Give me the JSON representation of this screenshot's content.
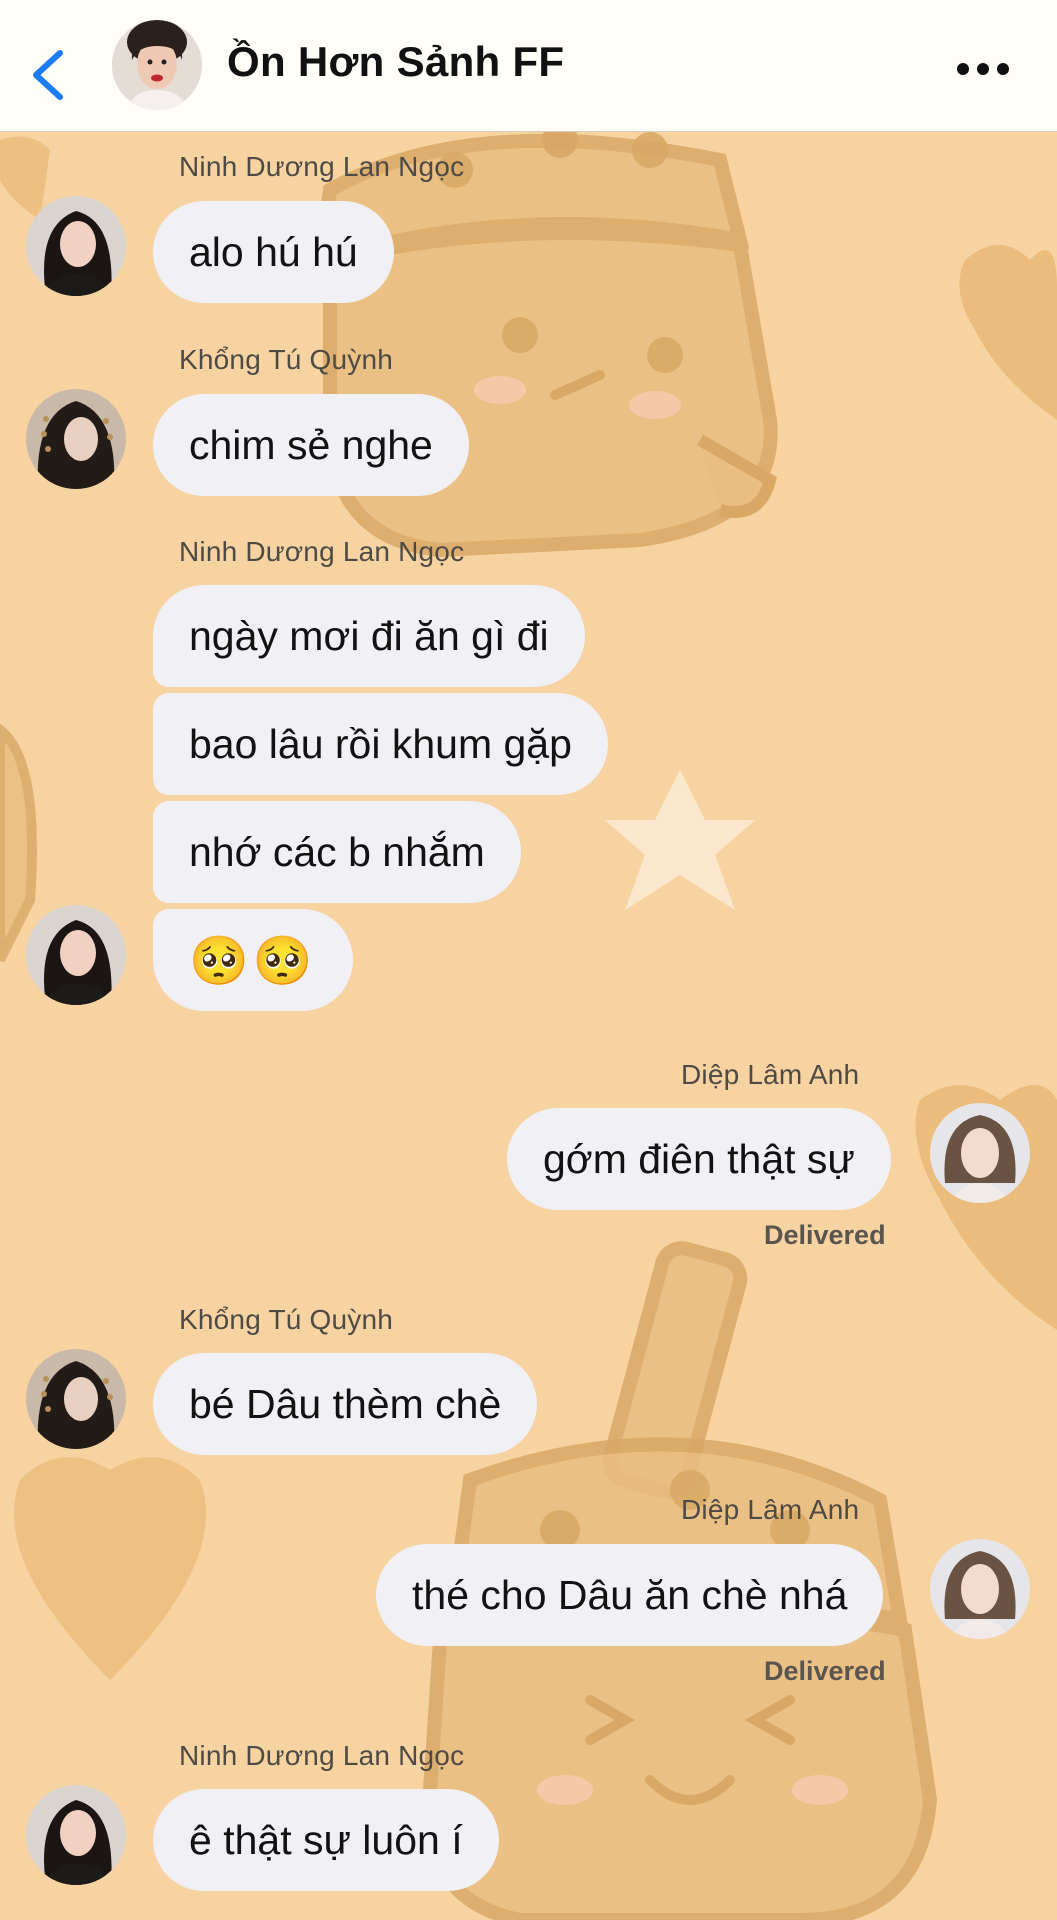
{
  "header": {
    "title": "Ồn Hơn Sảnh FF",
    "accent_color": "#1c7cf4",
    "back_icon": "chevron-left-icon",
    "more_icon": "more-horizontal-icon"
  },
  "wallpaper": {
    "theme": "bubble-tea cartoon pattern",
    "base_color": "#f6d3a0",
    "shape_color": "#e9b878"
  },
  "messages": [
    {
      "sender": "Ninh Dương Lan Ngọc",
      "side": "left",
      "texts": [
        "alo hú hú"
      ]
    },
    {
      "sender": "Khổng Tú Quỳnh",
      "side": "left",
      "texts": [
        "chim sẻ nghe"
      ]
    },
    {
      "sender": "Ninh Dương Lan Ngọc",
      "side": "left",
      "texts": [
        "ngày mơi đi ăn gì đi",
        "bao lâu rồi khum gặp",
        "nhớ các b nhắm",
        "🥺🥺"
      ]
    },
    {
      "sender": "Diệp Lâm Anh",
      "side": "right",
      "texts": [
        "gớm điên thật sự"
      ],
      "status": "Delivered"
    },
    {
      "sender": "Khổng Tú Quỳnh",
      "side": "left",
      "texts": [
        "bé Dâu thèm chè"
      ]
    },
    {
      "sender": "Diệp Lâm Anh",
      "side": "right",
      "texts": [
        "thé cho Dâu ăn chè nhá"
      ],
      "status": "Delivered"
    },
    {
      "sender": "Ninh Dương Lan Ngọc",
      "side": "left",
      "texts": [
        "ê thật sự luôn í"
      ]
    }
  ]
}
